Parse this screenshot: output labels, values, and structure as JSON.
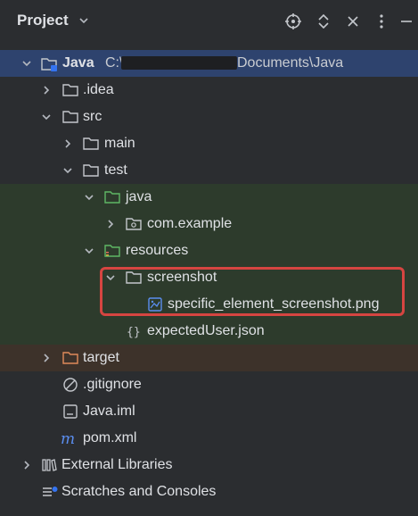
{
  "header": {
    "title": "Project"
  },
  "tree": {
    "root": {
      "label": "Java",
      "path_prefix": "C:\\",
      "path_suffix": "Documents\\Java"
    },
    "idea": "idea",
    "src": "src",
    "main": "main",
    "test": "test",
    "java_dir": "java",
    "com_example": "com.example",
    "resources": "resources",
    "screenshot": "screenshot",
    "png_file": "specific_element_screenshot.png",
    "expected_user": "expectedUser.json",
    "target": "target",
    "gitignore": ".gitignore",
    "java_iml": "Java.iml",
    "pom": "pom.xml",
    "external_libraries": "External Libraries",
    "scratches": "Scratches and Consoles"
  },
  "colors": {
    "background": "#2b2d30",
    "selected_row": "#2e436e",
    "test_sources_row": "#2d3b2c",
    "excluded_row": "#3d322a",
    "annotation_box": "#d64541"
  },
  "icons": [
    "chevron-down-icon",
    "crosshair-icon",
    "expand-collapse-icon",
    "close-icon",
    "more-icon",
    "folder-icon",
    "module-icon",
    "package-icon",
    "image-file-icon",
    "json-file-icon",
    "gitignore-icon",
    "iml-file-icon",
    "maven-icon",
    "libraries-icon",
    "scratches-icon"
  ]
}
